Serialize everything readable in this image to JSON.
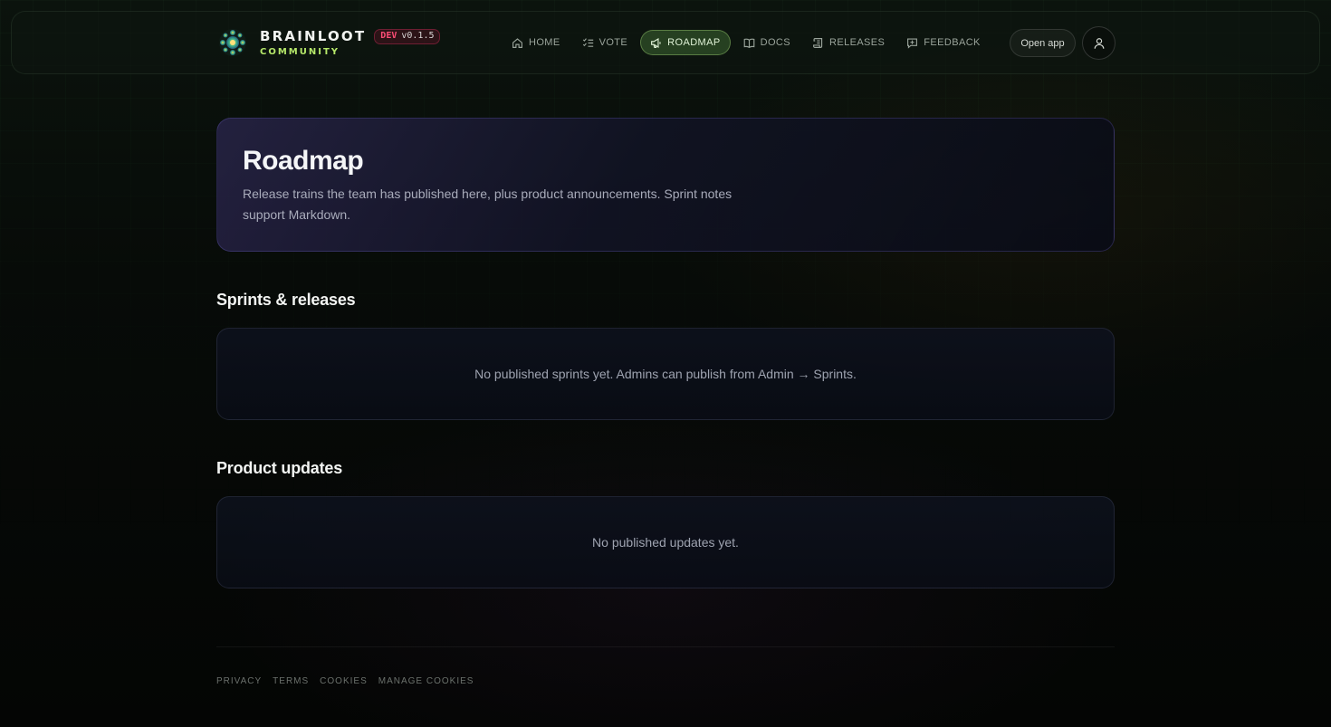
{
  "brand": {
    "name": "BRAINLOOT",
    "env": "DEV",
    "version": "v0.1.5",
    "subtitle": "COMMUNITY"
  },
  "nav": {
    "items": [
      {
        "label": "HOME",
        "icon": "home-icon",
        "active": false
      },
      {
        "label": "VOTE",
        "icon": "list-check-icon",
        "active": false
      },
      {
        "label": "ROADMAP",
        "icon": "megaphone-icon",
        "active": true
      },
      {
        "label": "DOCS",
        "icon": "book-open-icon",
        "active": false
      },
      {
        "label": "RELEASES",
        "icon": "scroll-icon",
        "active": false
      },
      {
        "label": "FEEDBACK",
        "icon": "message-plus-icon",
        "active": false
      }
    ]
  },
  "header": {
    "open_app_label": "Open app",
    "user_icon": "user-icon"
  },
  "hero": {
    "title": "Roadmap",
    "description": "Release trains the team has published here, plus product announcements. Sprint notes support Markdown."
  },
  "sprints": {
    "title": "Sprints & releases",
    "empty_text": "No published sprints yet. Admins can publish from Admin → Sprints."
  },
  "updates": {
    "title": "Product updates",
    "empty_text": "No published updates yet."
  },
  "footer": {
    "links": [
      "PRIVACY",
      "TERMS",
      "COOKIES",
      "MANAGE COOKIES"
    ]
  },
  "colors": {
    "accent_green": "#b6e86a",
    "dev_badge": "#ff4d76",
    "active_nav_bg": "#3c6432"
  }
}
